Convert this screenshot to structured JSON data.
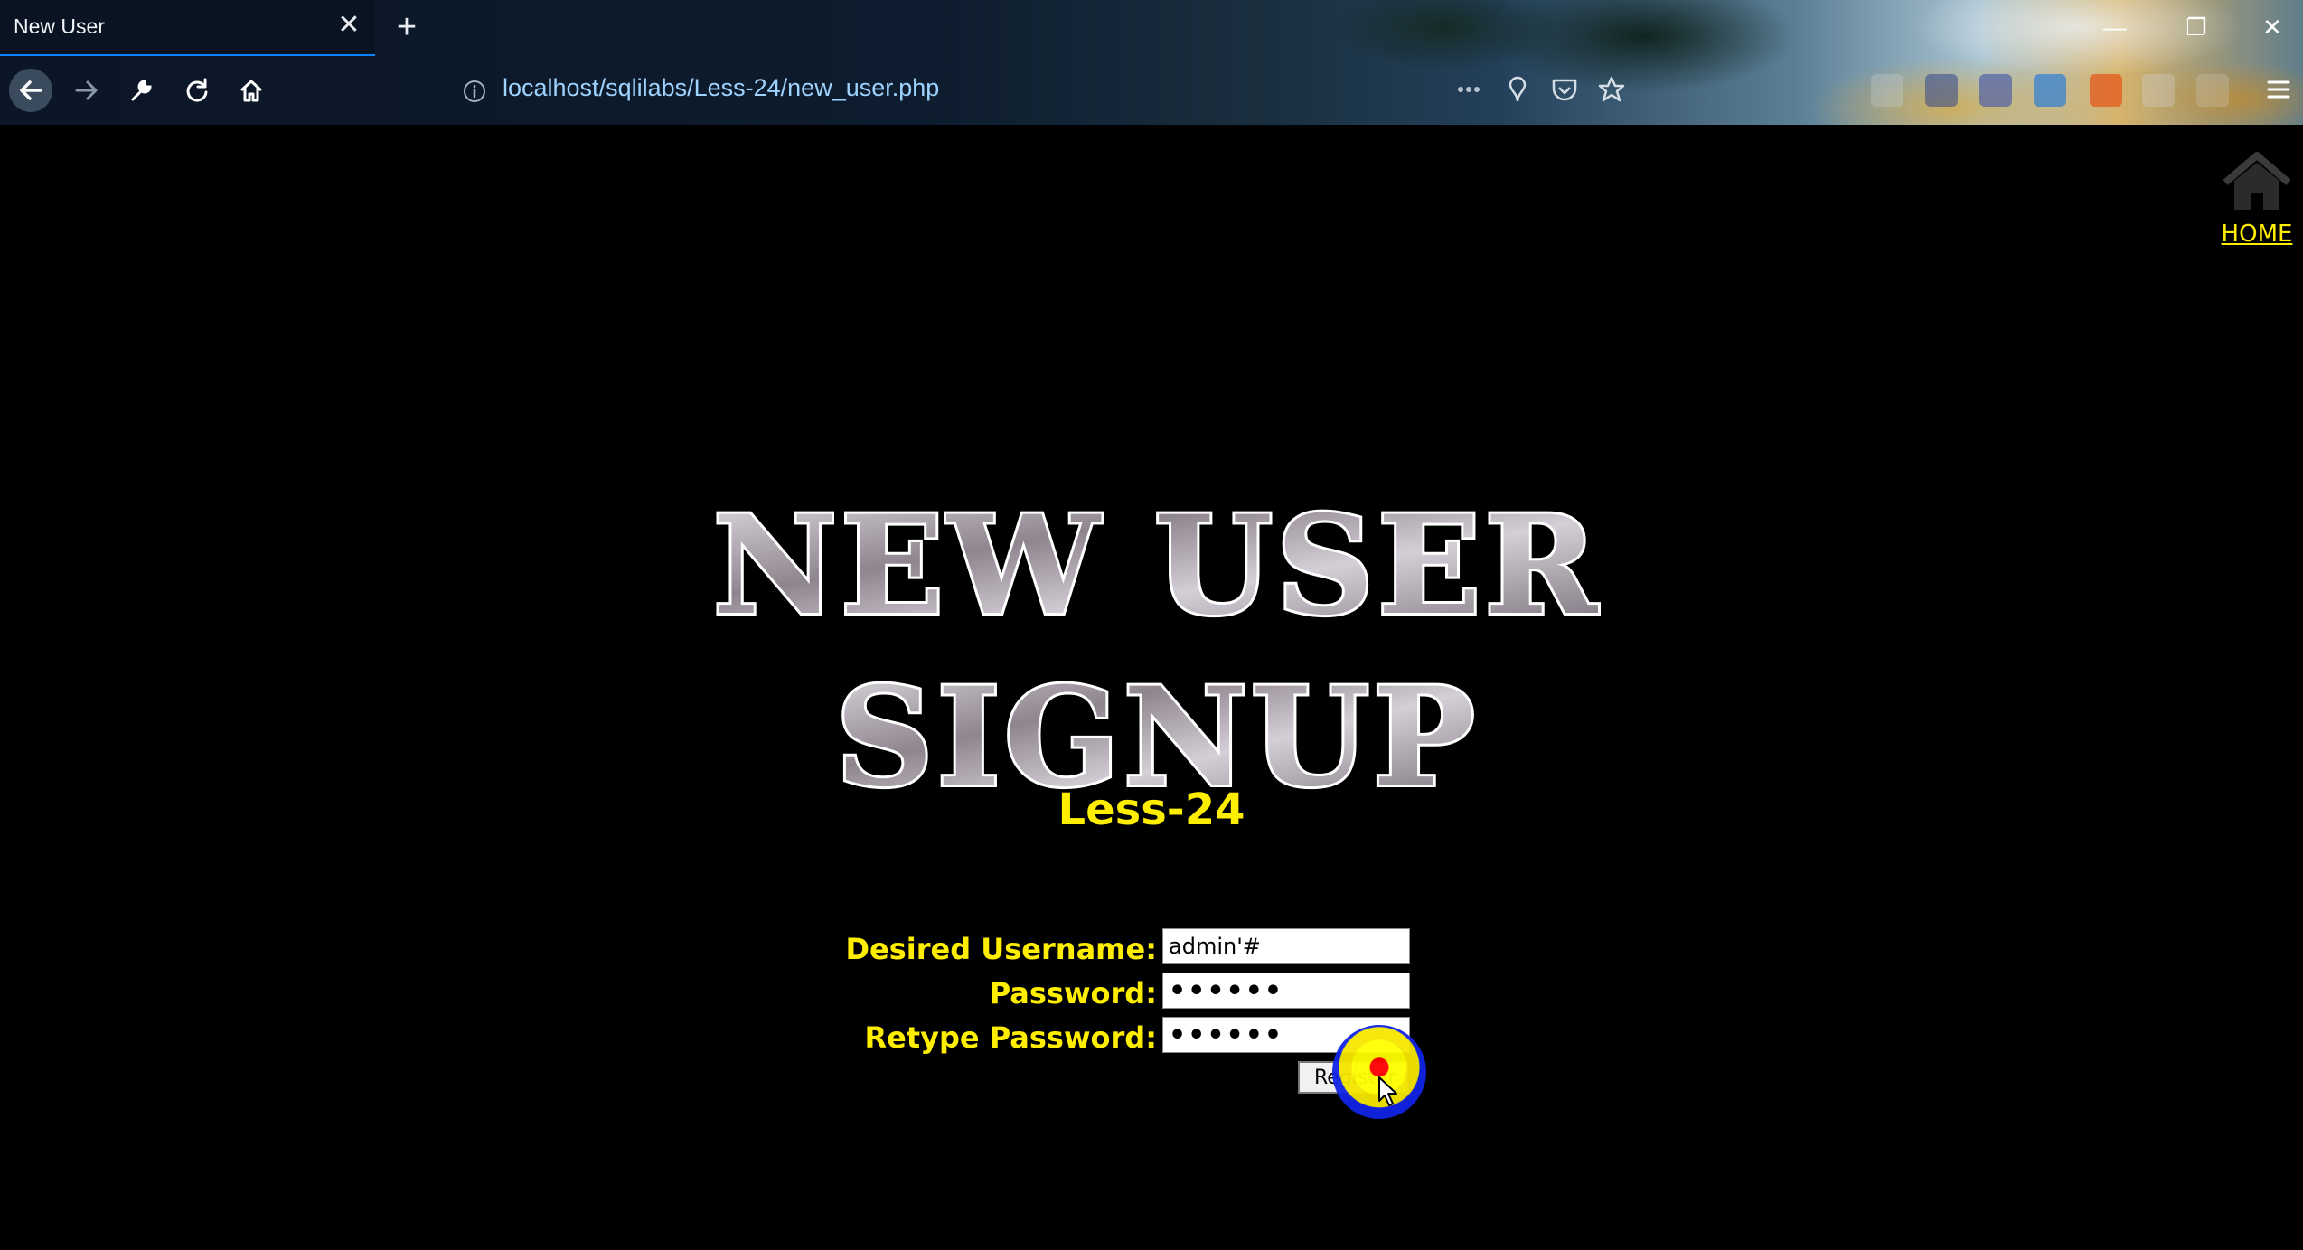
{
  "browser": {
    "tab_title": "New User",
    "tab_close": "✕",
    "new_tab": "+",
    "url": "localhost/sqlilabs/Less-24/new_user.php",
    "window_controls": {
      "minimize": "—",
      "restore": "❐",
      "close": "✕"
    },
    "toolbar_icons": [
      "back-icon",
      "forward-icon",
      "wrench-icon",
      "reload-icon",
      "home-icon"
    ],
    "url_bar_icons": [
      "info-icon",
      "more-icon",
      "pin-icon",
      "pocket-icon",
      "bookmark-star-icon"
    ]
  },
  "page": {
    "home_link": "HOME",
    "banner": [
      "NEW USER",
      "SIGNUP"
    ],
    "lesson": "Less-24",
    "form": {
      "username_label": "Desired Username:",
      "username_value": "admin'#",
      "password_label": "Password:",
      "password_value": "••••••",
      "retype_label": "Retype Password:",
      "retype_value": "••••••",
      "submit_label": "Register"
    }
  },
  "colors": {
    "page_bg": "#000000",
    "label_yellow": "#ffee00",
    "url_blue": "#9fd3ff",
    "banner_fill": "#c8c2c8",
    "banner_outline": "#ffffff"
  }
}
